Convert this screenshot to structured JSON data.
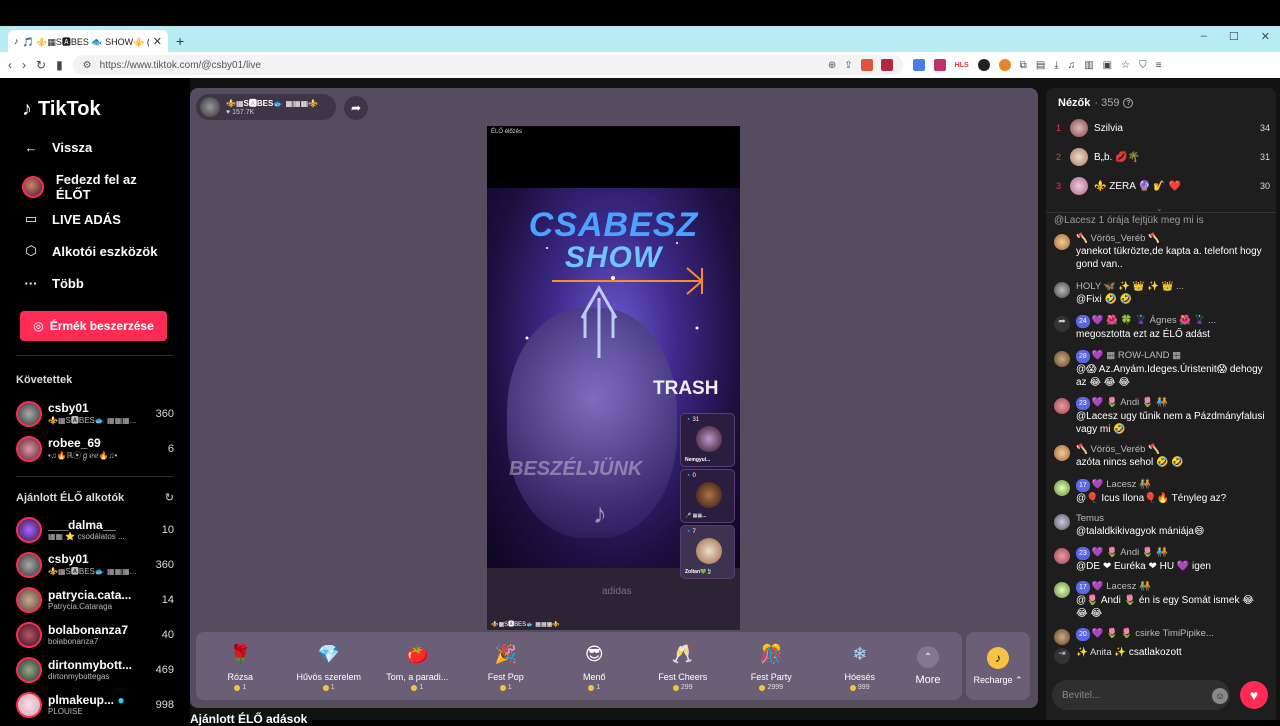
{
  "browser": {
    "tab_title": "🎵 ⚜️▦S🅰BES 🐟 SHOW⚜️ (@",
    "new_tab": "+",
    "url": "https://www.tiktok.com/@csby01/live",
    "window_controls": [
      "–",
      "☐",
      "✕"
    ]
  },
  "sidebar": {
    "logo": "TikTok",
    "nav": [
      {
        "label": "Vissza",
        "icon": "arrow-left-icon",
        "glyph": "←"
      },
      {
        "label": "Fedezd fel az ÉLŐT",
        "icon": "avatar",
        "glyph": ""
      },
      {
        "label": "LIVE ADÁS",
        "icon": "video-camera-icon",
        "glyph": "▭"
      },
      {
        "label": "Alkotói eszközök",
        "icon": "creator-tools-icon",
        "glyph": "⬡"
      },
      {
        "label": "Több",
        "icon": "more-dots-icon",
        "glyph": "···"
      }
    ],
    "coins_button": "Érmék beszerzése",
    "following_title": "Követettek",
    "following": [
      {
        "name": "csby01",
        "sub": "⚜️▦S🅰BES🐟 ▦▦▦...",
        "count": "360"
      },
      {
        "name": "robee_69",
        "sub": "•♫🔥ℝ⦿ℊℯℯ🔥♫•",
        "count": "6"
      }
    ],
    "recommended_title": "Ajánlott ÉLŐ alkotók",
    "recommended": [
      {
        "name": "___dalma__",
        "sub": "▦▦ ⭐ csodálatos ...",
        "count": "10"
      },
      {
        "name": "csby01",
        "sub": "⚜️▦S🅰BES🐟 ▦▦▦...",
        "count": "360"
      },
      {
        "name": "patrycia.cata...",
        "sub": "Patrycia.Cataraga",
        "count": "14"
      },
      {
        "name": "bolabonanza7",
        "sub": "bolabonanza7",
        "count": "40"
      },
      {
        "name": "dirtonmybott...",
        "sub": "dirtonmybottegas",
        "count": "469"
      },
      {
        "name": "plmakeup...",
        "sub": "PLOUISE",
        "count": "998"
      }
    ]
  },
  "stream": {
    "host_name": "⚜️▦S🅰BES🐟 ▦▦▦⚜️",
    "host_likes": "♥ 157.7K",
    "live_label": "ÉLŐ élőzés",
    "title_line1": "CSABESZ",
    "title_line2": "SHOW",
    "overlay_trash": "TRASH",
    "overlay_text": "BESZÉLJÜNK",
    "brand": "adidas",
    "bottom_label": "⚜️▦S🅰BES🐟 ▦▦▦⚜️",
    "guests": [
      {
        "count": "🔹31",
        "name": "Nemgyul..."
      },
      {
        "count": "🔹0",
        "name": "🎤 ▦▦..."
      },
      {
        "count": "🔹7",
        "name": "Zoltan💚🍃"
      }
    ]
  },
  "gifts": [
    {
      "name": "Rózsa",
      "price": "1",
      "glyph": "🌹",
      "color": "#d9304f"
    },
    {
      "name": "Hűvös szerelem",
      "price": "1",
      "glyph": "💎",
      "color": "#7fd6e8"
    },
    {
      "name": "Tom, a paradi...",
      "price": "1",
      "glyph": "🍅",
      "color": "#e84a2a"
    },
    {
      "name": "Fest Pop",
      "price": "1",
      "glyph": "🎉",
      "color": "#3bd2c4"
    },
    {
      "name": "Menő",
      "price": "1",
      "glyph": "😎",
      "color": "#f2c230"
    },
    {
      "name": "Fest Cheers",
      "price": "299",
      "glyph": "🥂",
      "color": "#4aa3ff"
    },
    {
      "name": "Fest Party",
      "price": "2999",
      "glyph": "🎊",
      "color": "#d23fd0"
    },
    {
      "name": "Hóesés",
      "price": "999",
      "glyph": "❄",
      "color": "#a8d8ff"
    }
  ],
  "more_label": "More",
  "recharge_label": "Recharge ⌃",
  "below_title": "Ajánlott ÉLŐ adások",
  "chat": {
    "viewers_label": "Nézők",
    "viewers_count": "· 359",
    "top_viewers": [
      {
        "rank": "1",
        "name": "Szilvia",
        "score": "34"
      },
      {
        "rank": "2",
        "name": "B„b. 💋🌴",
        "score": "31"
      },
      {
        "rank": "3",
        "name": "⚜️ ZERA 🔮 🎷 ❤️",
        "score": "30"
      }
    ],
    "messages": [
      {
        "name": "",
        "text": "@Lacesz 1 órája fejtjük meg mi is",
        "badge": ""
      },
      {
        "name": "🪓 Vörös_Veréb 🪓",
        "text": "yanekot tükrözte,de kapta a. telefont hogy gond van..",
        "badge": ""
      },
      {
        "name": "HOLY 🦋 ✨ 👑 ✨ 👑 ...",
        "text": "@Fixi 🤣 🤣",
        "badge": ""
      },
      {
        "name": "💜 🌺 🍀 🦹 Ágnes 🌺 🦹 ...",
        "text": "megosztotta ezt az ÉLŐ adást",
        "badge": "24"
      },
      {
        "name": "💜 ▦ ROW-LAND ▦",
        "text": "@😱 Az.Anyám.Ideges.Úristenit😱 dehogy az 😂 😂 😂",
        "badge": "28"
      },
      {
        "name": "💜 🌷 Andi 🌷 🧑‍🤝‍🧑",
        "text": "@Lacesz ugy tűnik nem a Pázdmányfalusi vagy mi 🤣",
        "badge": "23"
      },
      {
        "name": "🪓 Vörös_Veréb 🪓",
        "text": "azóta nincs sehol 🤣 🤣",
        "badge": ""
      },
      {
        "name": "💜 Lacesz 🧑‍🤝‍🧑",
        "text": "@🎈 Icus Ilona🎈🔥 Tényleg az?",
        "badge": "17"
      },
      {
        "name": "Temus",
        "text": "@talaldkikivagyok mániája😄",
        "badge": ""
      },
      {
        "name": "💜 🌷 Andi 🌷 🧑‍🤝‍🧑",
        "text": "@DE ❤ Euréka ❤ HU 💜 igen",
        "badge": "23"
      },
      {
        "name": "💜 Lacesz 🧑‍🤝‍🧑",
        "text": "@🌷 Andi 🌷 én is egy Somát ismek 😂 😂 😂",
        "badge": "17"
      },
      {
        "name": "💜 🌷 🌷 csirke TimiPipike...",
        "text": "",
        "badge": "20"
      },
      {
        "name": "✨ Anita ✨",
        "text": "csatlakozott",
        "badge": ""
      }
    ],
    "input_placeholder": "Bevitel..."
  }
}
